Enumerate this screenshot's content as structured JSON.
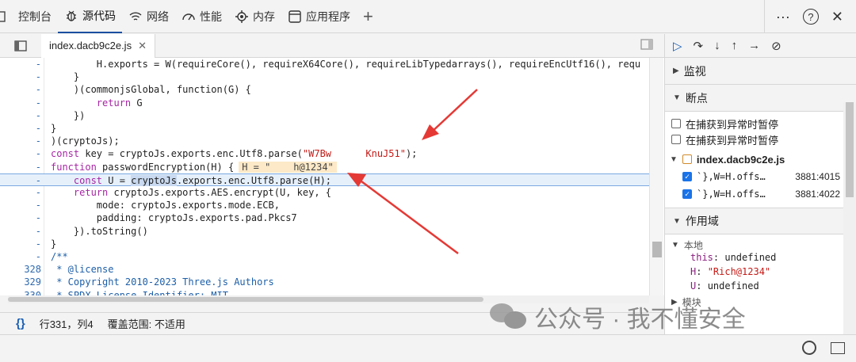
{
  "toptabs": [
    {
      "label": "控制台",
      "icon": "console-icon"
    },
    {
      "label": "源代码",
      "icon": "bug-icon",
      "active": true
    },
    {
      "label": "网络",
      "icon": "wifi-icon"
    },
    {
      "label": "性能",
      "icon": "gauge-icon"
    },
    {
      "label": "内存",
      "icon": "chip-icon"
    },
    {
      "label": "应用程序",
      "icon": "app-icon"
    }
  ],
  "toolbar_right": {
    "more": "···",
    "help": "?",
    "close": "✕",
    "add": "+"
  },
  "editor": {
    "file_tab": "index.dacb9c2e.js",
    "lines": [
      {
        "ln": "-",
        "code": "        H.exports = W(requireCore(), requireX64Core(), requireLibTypedarrays(), requireEncUtf16(), requ"
      },
      {
        "ln": "-",
        "code": "    }"
      },
      {
        "ln": "-",
        "code": "    )(commonjsGlobal, function(G) {"
      },
      {
        "ln": "-",
        "code": "        return G"
      },
      {
        "ln": "-",
        "code": "    })"
      },
      {
        "ln": "-",
        "code": "}"
      },
      {
        "ln": "-",
        "code": ")(cryptoJs);"
      },
      {
        "ln": "-",
        "code": "const key = cryptoJs.exports.enc.Utf8.parse(\"W7Bw      KnuJ51\");"
      },
      {
        "ln": "-",
        "code": "function passwordEncryption(H) {"
      },
      {
        "ln": "-",
        "code": "    const U = cryptoJs.exports.enc.Utf8.parse(H);"
      },
      {
        "ln": "-",
        "code": "    return cryptoJs.exports.AES.encrypt(U, key, {"
      },
      {
        "ln": "-",
        "code": "        mode: cryptoJs.exports.mode.ECB,"
      },
      {
        "ln": "-",
        "code": "        padding: cryptoJs.exports.pad.Pkcs7"
      },
      {
        "ln": "-",
        "code": "    }).toString()"
      },
      {
        "ln": "-",
        "code": "}"
      },
      {
        "ln": "-",
        "code": "/**"
      },
      {
        "ln": "328",
        "code": " * @license"
      },
      {
        "ln": "329",
        "code": " * Copyright 2010-2023 Three.js Authors"
      },
      {
        "ln": "330",
        "code": " * SPDX-License-Identifier: MIT"
      }
    ],
    "inline_value": "H = \"    h@1234\""
  },
  "status": {
    "braces": "{}",
    "position": "行331，列4",
    "coverage": "覆盖范围: 不适用"
  },
  "debugger": {
    "watch_label": "监视",
    "breakpoints_label": "断点",
    "pause_caught": "在捕获到异常时暂停",
    "pause_uncaught": "在捕获到异常时暂停",
    "bp_file": "index.dacb9c2e.js",
    "bp_items": [
      {
        "code": "`},W=H.offs…",
        "loc": "3881:4015"
      },
      {
        "code": "`},W=H.offs…",
        "loc": "3881:4022"
      }
    ],
    "scope_label": "作用域",
    "local_label": "本地",
    "vars": [
      {
        "key": "this",
        "value": "undefined"
      },
      {
        "key": "H",
        "value": "\"Rich@1234\""
      },
      {
        "key": "U",
        "value": "undefined"
      }
    ],
    "module_label": "模块"
  },
  "watermark": "公众号 · 我不懂安全"
}
